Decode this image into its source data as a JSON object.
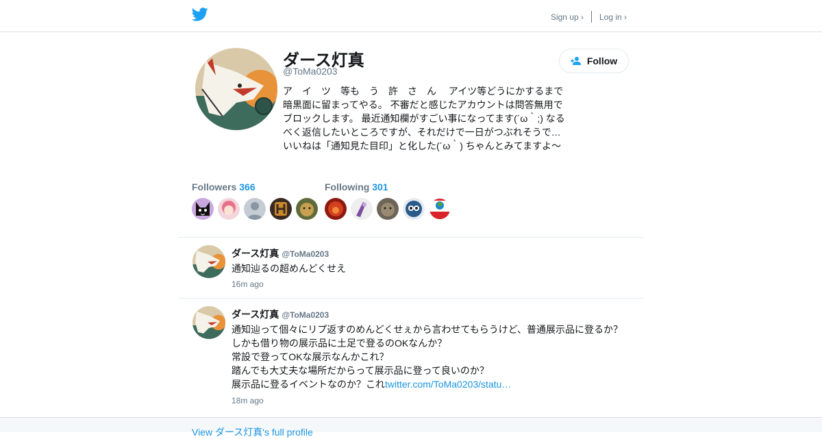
{
  "header": {
    "signup_label": "Sign up ›",
    "login_label": "Log in ›",
    "brand_color": "#1da1f2"
  },
  "profile": {
    "name": "ダース灯真",
    "handle": "@ToMa0203",
    "bio": "ア　イ　ツ　等も　う　許　さ　ん　 アイツ等どうにかするまで暗黒面に留まってやる。 不審だと感じたアカウントは問答無用でブロックします。 最近通知欄がすごい事になってます(´ω｀;) なるべく返信したいところですが、それだけで一日がつぶれそうで… いいねは「通知見た目印」と化した(´ω｀) ちゃんとみてますよ～",
    "follow_label": "Follow"
  },
  "stats": {
    "followers_label": "Followers",
    "followers_count": "366",
    "following_label": "Following",
    "following_count": "301"
  },
  "tweets": [
    {
      "name": "ダース灯真",
      "handle": "@ToMa0203",
      "text": "通知辿るの超めんどくせえ",
      "time": "16m ago"
    },
    {
      "name": "ダース灯真",
      "handle": "@ToMa0203",
      "lines": [
        "通知辿って個々にリプ返すのめんどくせぇから言わせてもらうけど、普通展示品に登るか？",
        "しかも借り物の展示品に土足で登るのOKなんか？",
        "常設で登ってOKな展示なんかこれ？",
        "踏んでも大丈夫な場所だからって展示品に登って良いのか？",
        "展示品に登るイベントなのか？これ"
      ],
      "link": "twitter.com/ToMa0203/statu…",
      "time": "18m ago"
    }
  ],
  "footer": {
    "link_label": "View ダース灯真's full profile"
  }
}
